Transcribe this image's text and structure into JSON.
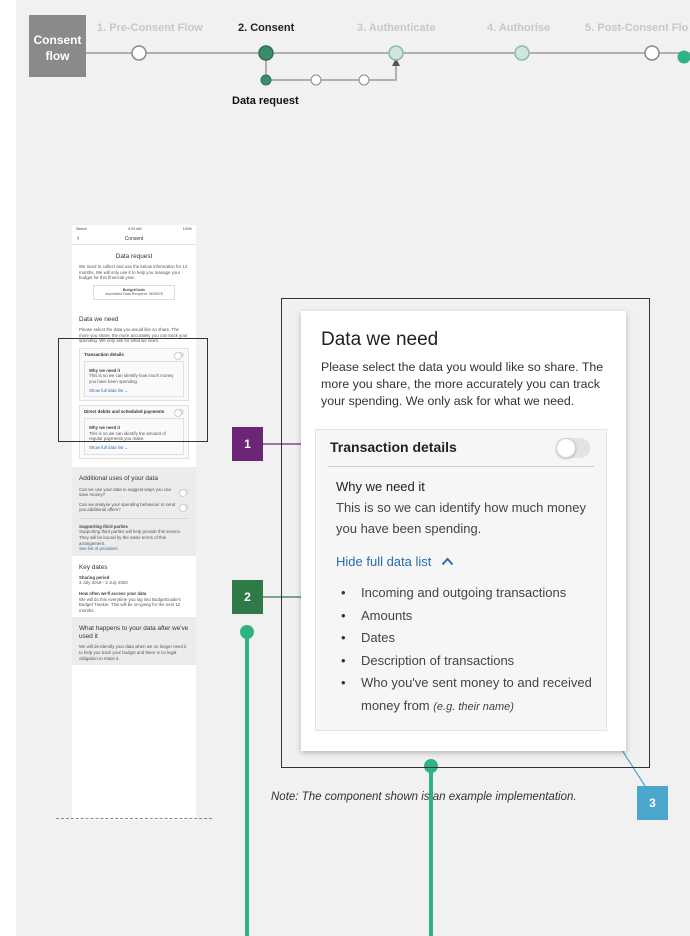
{
  "flow": {
    "label": "Consent flow",
    "steps": [
      {
        "label": "1. Pre-Consent Flow",
        "active": false
      },
      {
        "label": "2. Consent",
        "active": true
      },
      {
        "label": "3. Authenticate",
        "active": false
      },
      {
        "label": "4. Authorise",
        "active": false
      },
      {
        "label": "5. Post-Consent Flo",
        "active": false
      }
    ],
    "subflow_label": "Data request"
  },
  "phone": {
    "status_left": "Sketch",
    "status_time": "9:20 AM",
    "status_right": "100%",
    "back_icon": "chevron-left-icon",
    "nav_title": "Consent",
    "data_request_title": "Data request",
    "data_request_text": "We need to collect and use the below information for 12 months. We will only use it to help you manage your budget for this financial year.",
    "recipient_name": "BudgetGuide",
    "recipient_sub": "Accredited Data Recipient: 9635978",
    "data_we_need_title": "Data we need",
    "data_we_need_text": "Please select the data you would like so share. The more you share, the more accurately you can track your spending. We only ask for what we need.",
    "transaction_details": "Transaction details",
    "why_need_title": "Why we need it",
    "why_need_text": "This is so we can identify how much money you have been spending.",
    "show_full_list": "Show full data list",
    "direct_debits": "Direct debits and scheduled payments",
    "direct_why_text": "This is so we can identify the amount of regular payments you make.",
    "additional_uses_title": "Additional uses of your data",
    "q1": "Can we use your data to suggest ways you can save money?",
    "q2": "Can we analyse your spending behaviour to send you additional offers?",
    "third_parties_title": "Supporting third parties",
    "third_parties_text": "Supporting third parties will help provide this service. They will be bound by the same terms of this arrangement.",
    "providers_link": "See list of providers",
    "key_dates_title": "Key dates",
    "sharing_period_title": "Sharing period",
    "sharing_period_value": "3 July 2019 - 2 July 2020",
    "access_title": "How often we'll access your data",
    "access_text": "We will do this everytime you log into BudgetGuide's Budget Tracker. This will be on-going for the next 12 months.",
    "after_title": "What happens to your data after we've used it",
    "after_text": "We will de-identify your data when we no longer need it to help you track your budget and there is no legal obligation to retain it."
  },
  "component": {
    "title": "Data we need",
    "description": "Please select the data you would like so share. The more you share, the more accurately you can track your spending. We only ask for what we need.",
    "transaction_label": "Transaction details",
    "toggle_on": false,
    "why_title": "Why we need it",
    "why_text": "This is so we can identify how much money you have been spending.",
    "hide_link": "Hide full data list",
    "hide_icon": "chevron-up-icon",
    "items": [
      "Incoming and outgoing transactions",
      "Amounts",
      "Dates",
      "Description of transactions"
    ],
    "last_item": "Who you've sent money to and received money from",
    "last_item_example": "(e.g. their name)"
  },
  "annotations": {
    "badge1": "1",
    "badge2": "2",
    "badge3": "3",
    "note": "Note: The component shown is an example implementation."
  },
  "colors": {
    "green_accent": "#2fb383",
    "purple_badge": "#6b2675",
    "green_badge": "#2f7a46",
    "blue_badge": "#4aa6cc",
    "link": "#2a6cb0"
  }
}
